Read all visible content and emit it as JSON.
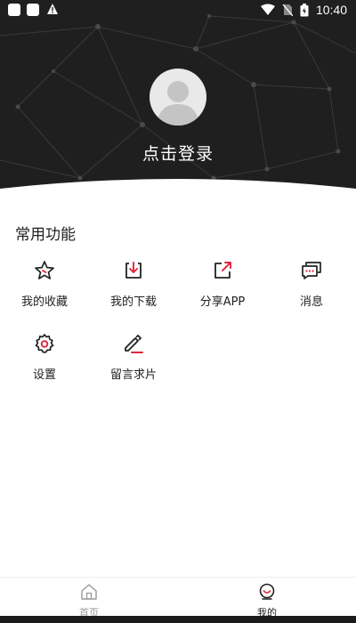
{
  "status_bar": {
    "time": "10:40"
  },
  "profile": {
    "login_text": "点击登录"
  },
  "section": {
    "title": "常用功能"
  },
  "functions": [
    {
      "label": "我的收藏",
      "icon": "star-icon"
    },
    {
      "label": "我的下载",
      "icon": "download-icon"
    },
    {
      "label": "分享APP",
      "icon": "share-icon"
    },
    {
      "label": "消息",
      "icon": "message-icon"
    },
    {
      "label": "设置",
      "icon": "gear-icon"
    },
    {
      "label": "留言求片",
      "icon": "edit-icon"
    }
  ],
  "tabs": [
    {
      "label": "首页",
      "icon": "home-icon",
      "active": false
    },
    {
      "label": "我的",
      "icon": "profile-icon",
      "active": true
    }
  ],
  "colors": {
    "accent": "#e0233a",
    "header_bg": "#1f1f1f",
    "inactive": "#9a9a9a"
  }
}
